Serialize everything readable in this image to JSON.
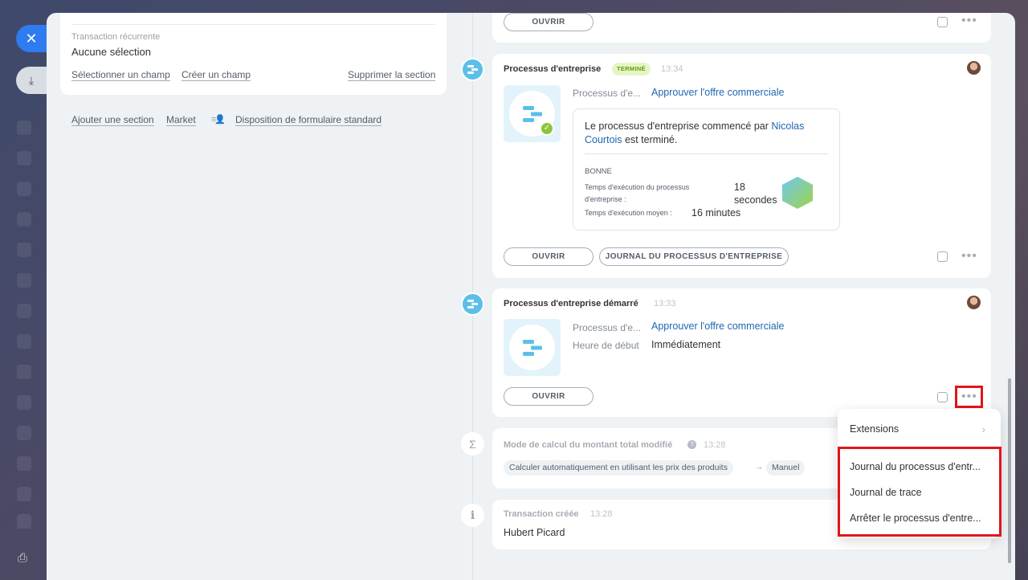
{
  "left_form": {
    "recurring_label": "Transaction récurrente",
    "recurring_value": "Aucune sélection",
    "select_field": "Sélectionner un champ",
    "create_field": "Créer un champ",
    "delete_section": "Supprimer la section",
    "add_section": "Ajouter une section",
    "market": "Market",
    "standard_layout": "Disposition de formulaire standard"
  },
  "timeline": {
    "top_card": {
      "open_btn": "OUVRIR"
    },
    "bp_done": {
      "title": "Processus d'entreprise",
      "badge": "TERMINÉ",
      "time": "13:34",
      "process_label": "Processus d'e...",
      "process_link": "Approuver l'offre commerciale",
      "msg_prefix": "Le processus d'entreprise commencé par ",
      "msg_user": "Nicolas Courtois",
      "msg_suffix": " est terminé.",
      "rating": "BONNE",
      "exec_time_label": "Temps d'exécution du processus d'entreprise :",
      "exec_time_value": "18 secondes",
      "avg_time_label": "Temps d'exécution moyen :",
      "avg_time_value": "16 minutes",
      "open_btn": "OUVRIR",
      "log_btn": "JOURNAL DU PROCESSUS D'ENTREPRISE"
    },
    "bp_started": {
      "title": "Processus d'entreprise démarré",
      "time": "13:33",
      "process_label": "Processus d'e...",
      "process_link": "Approuver l'offre commerciale",
      "start_label": "Heure de début",
      "start_value": "Immédiatement",
      "open_btn": "OUVRIR"
    },
    "calc_mode": {
      "title": "Mode de calcul du montant total modifié",
      "time": "13:28",
      "from": "Calculer automatiquement en utilisant les prix des produits",
      "arrow": "→",
      "to": "Manuel"
    },
    "created": {
      "title": "Transaction créée",
      "time": "13:28",
      "user": "Hubert Picard"
    }
  },
  "menu": {
    "extensions": "Extensions",
    "items": [
      "Journal du processus d'entr...",
      "Journal de trace",
      "Arrêter le processus d'entre..."
    ]
  },
  "colors": {
    "accent": "#2f7bf0",
    "link": "#2067b0",
    "highlight": "#e0161d",
    "badge_bg": "#e5f6c6"
  }
}
